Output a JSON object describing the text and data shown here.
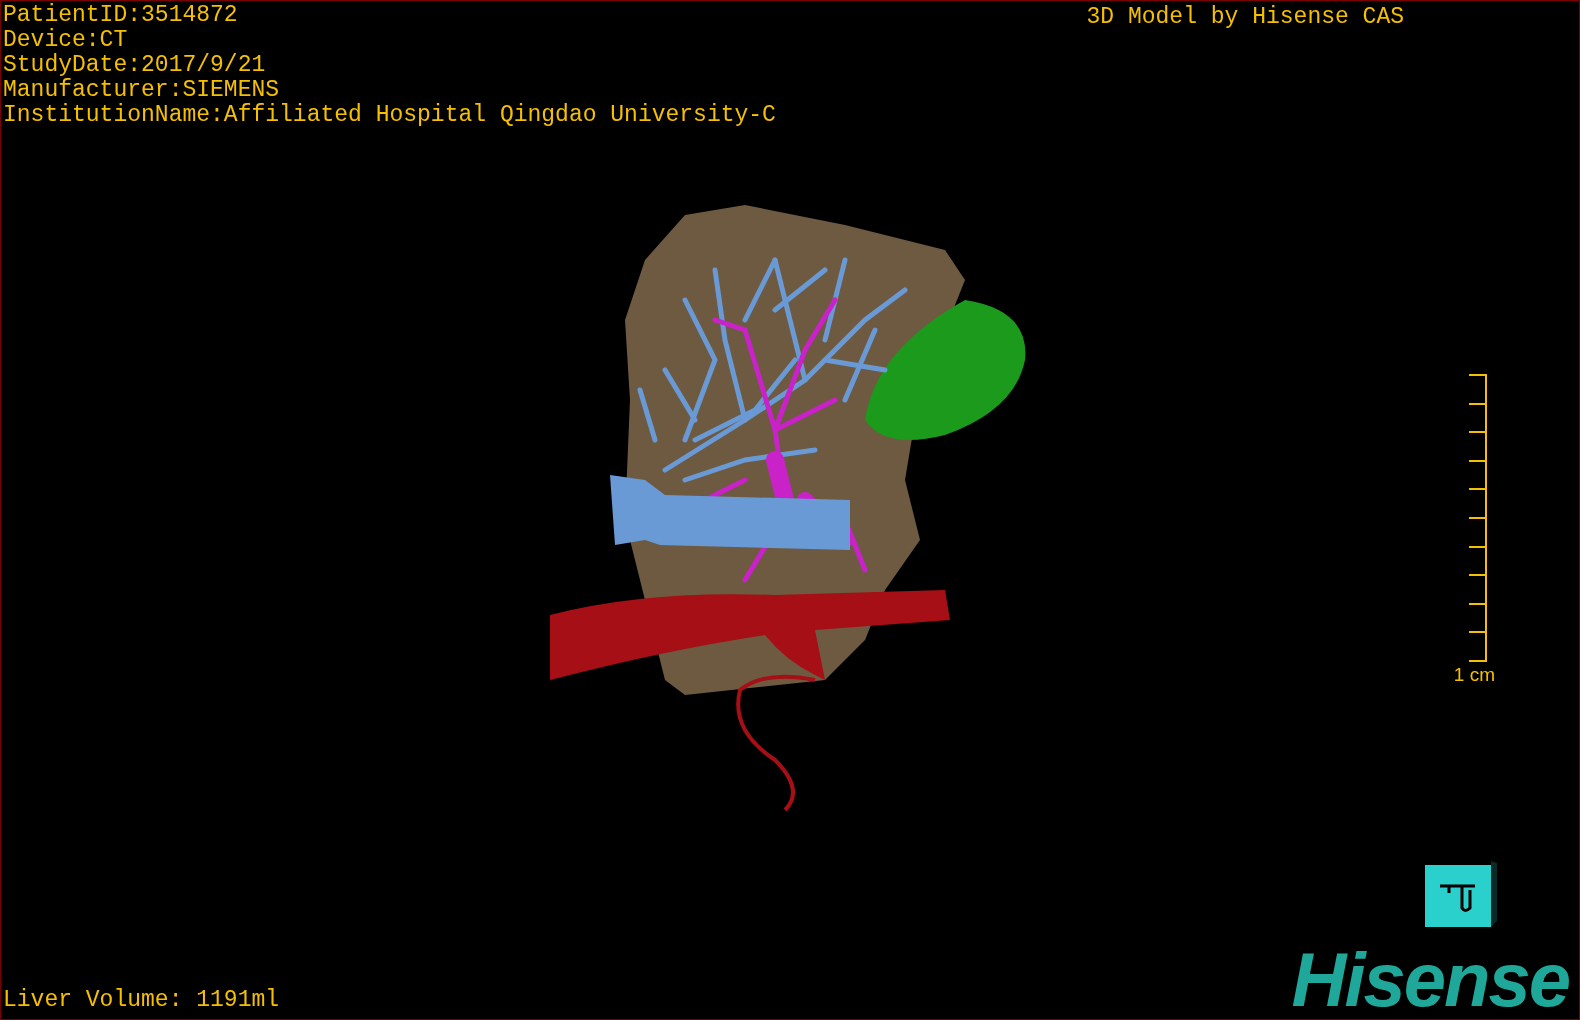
{
  "overlay": {
    "patient_info": [
      "PatientID:3514872",
      "Device:CT",
      "StudyDate:2017/9/21",
      "Manufacturer:SIEMENS",
      "InstitutionName:Affiliated Hospital Qingdao University-C"
    ],
    "title": "3D Model by Hisense CAS",
    "scale_bar": {
      "label": "1 cm"
    },
    "liver_volume": "Liver Volume: 1191ml",
    "logo": "Hisense"
  }
}
